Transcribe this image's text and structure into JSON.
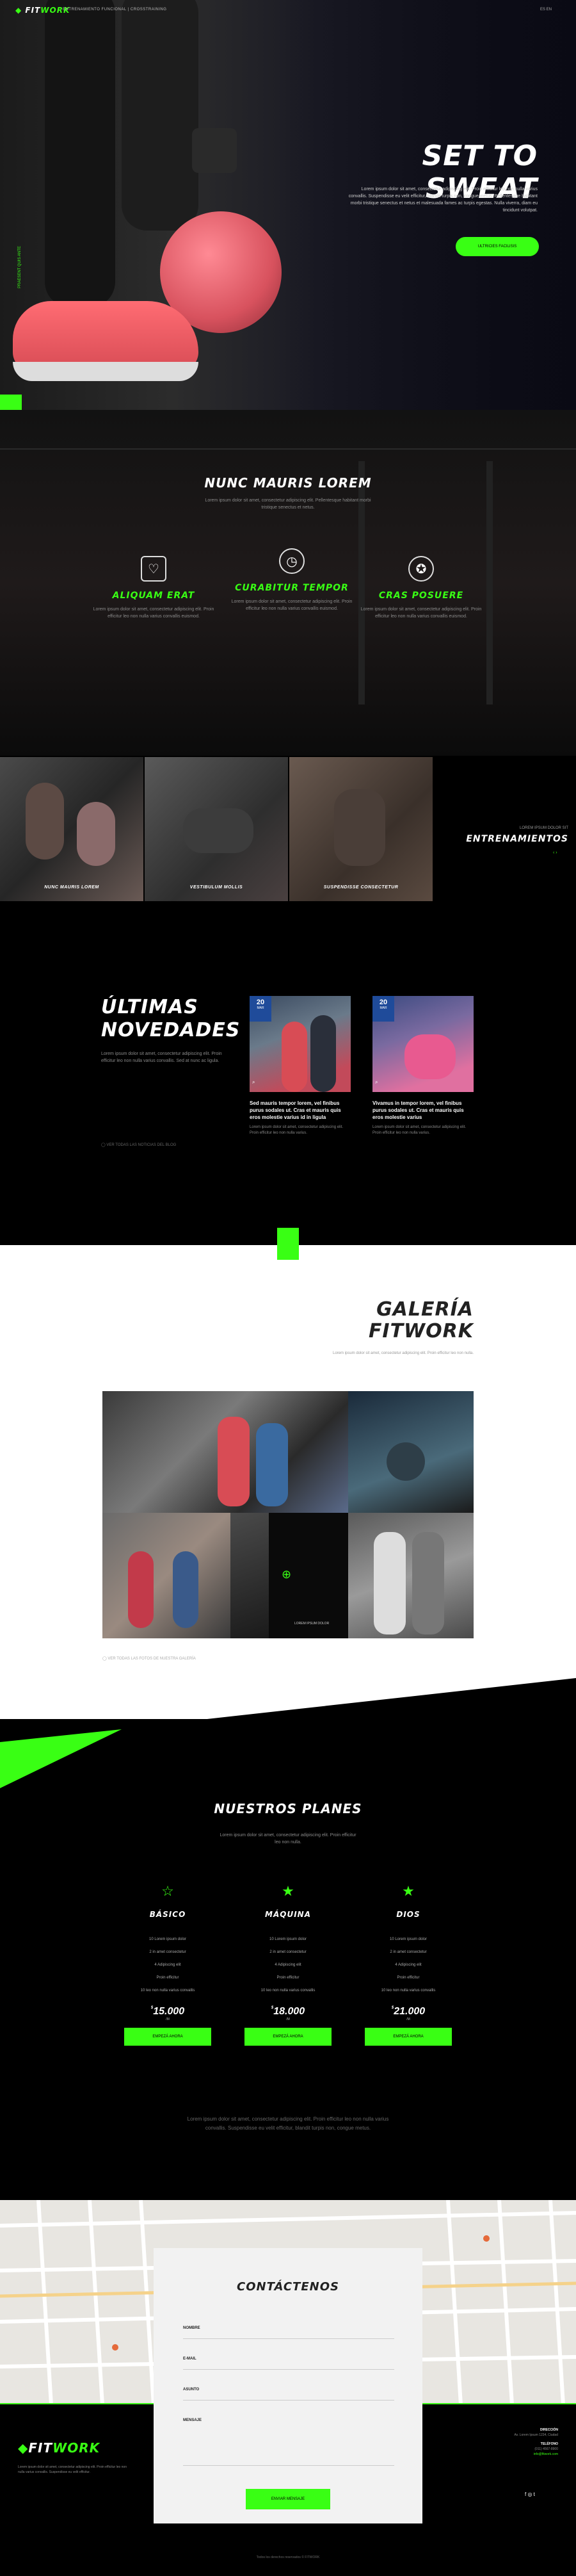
{
  "colors": {
    "accent": "#39ff14",
    "dark": "#000000",
    "date_badge": "#1f4b9a"
  },
  "header": {
    "logo_prefix": "FIT",
    "logo_suffix": "WORK",
    "tagline": "ENTRENAMIENTO FUNCIONAL | CROSSTRAINING",
    "lang": "ES  EN"
  },
  "hero": {
    "title": "SET TO SWEAT",
    "text": "Lorem ipsum dolor sit amet, consectetur adipiscing elit. Proin efficitur leo non nulla varius convallis. Suspendisse eu velit efficitur, blandit turpis non, congue metus. Pellentesque habitant morbi tristique senectus et netus et malesuada fames ac turpis egestas. Nulla viverra, diam eu tincidunt volutpat.",
    "button": "ULTRICIES FACILISIS",
    "side_text": "PRAESENT QUIS ANTE"
  },
  "features": {
    "title": "NUNC MAURIS LOREM",
    "subtitle": "Lorem ipsum dolor sit amet, consectetur adipiscing elit. Pellentesque habitant morbi tristique senectus et netus.",
    "items": [
      {
        "icon": "clipboard-heart-icon",
        "glyph": "♡",
        "title": "ALIQUAM ERAT",
        "text": "Lorem ipsum dolor sit amet, consectetur adipiscing elit. Proin efficitur leo non nulla varius convallis euismod."
      },
      {
        "icon": "stopwatch-icon",
        "glyph": "◷",
        "title": "CURABITUR TEMPOR",
        "text": "Lorem ipsum dolor sit amet, consectetur adipiscing elit. Proin efficitur leo non nulla varius convallis euismod."
      },
      {
        "icon": "medal-icon",
        "glyph": "✪",
        "title": "CRAS POSUERE",
        "text": "Lorem ipsum dolor sit amet, consectetur adipiscing elit. Proin efficitur leo non nulla varius convallis euismod."
      }
    ]
  },
  "classes": {
    "tiles": [
      {
        "label": "NUNC MAURIS LOREM"
      },
      {
        "label": "VESTIBULUM MOLLIS"
      },
      {
        "label": "SUSPENDISSE CONSECTETUR"
      }
    ],
    "kicker": "LOREM IPSUM DOLOR SIT",
    "title": "ENTRENAMIENTOS",
    "nav": "‹ ›"
  },
  "news": {
    "title_line1": "ÚLTIMAS",
    "title_line2": "NOVEDADES",
    "text": "Lorem ipsum dolor sit amet, consectetur adipiscing elit. Proin efficitur leo non nulla varius convallis. Sed at nunc ac ligula.",
    "more": "VER TODAS LAS NOTICIAS DEL BLOG",
    "cards": [
      {
        "day": "20",
        "month": "MAR",
        "title": "Sed mauris tempor lorem, vel finibus purus sodales ut. Cras et mauris quis eros molestie varius id in ligula",
        "text": "Lorem ipsum dolor sit amet, consectetur adipiscing elit. Proin efficitur leo non nulla varius."
      },
      {
        "day": "20",
        "month": "MAR",
        "title": "Vivamus in tempor lorem, vel finibus purus sodales ut. Cras et mauris quis eros molestie varius",
        "text": "Lorem ipsum dolor sit amet, consectetur adipiscing elit. Proin efficitur leo non nulla varius."
      }
    ]
  },
  "gallery": {
    "title_line1": "GALERÍA",
    "title_line2": "FITWORK",
    "subtitle": "Lorem ipsum dolor sit amet, consectetur adipiscing elit. Proin efficitur leo non nulla.",
    "overlay_caption": "LOREM IPSUM DOLOR",
    "note": "VER TODAS LAS FOTOS DE NUESTRA GALERÍA"
  },
  "plans": {
    "title": "NUESTROS PLANES",
    "subtitle": "Lorem ipsum dolor sit amet, consectetur adipiscing elit. Proin efficitur leo non nulla.",
    "items": [
      {
        "name": "BÁSICO",
        "features": [
          "10 Lorem ipsum dolor",
          "2 in amet consectetur",
          "4 Adipiscing elit",
          "Proin efficitur",
          "10 leo non nulla varius convallis"
        ],
        "currency": "$",
        "price": "15.000",
        "per": "/M",
        "button": "EMPEZÁ AHORA"
      },
      {
        "name": "MÁQUINA",
        "features": [
          "10 Lorem ipsum dolor",
          "2 in amet consectetur",
          "4 Adipiscing elit",
          "Proin efficitur",
          "10 leo non nulla varius convallis"
        ],
        "currency": "$",
        "price": "18.000",
        "per": "/M",
        "button": "EMPEZÁ AHORA"
      },
      {
        "name": "DIOS",
        "features": [
          "10 Lorem ipsum dolor",
          "2 in amet consectetur",
          "4 Adipiscing elit",
          "Proin efficitur",
          "10 leo non nulla varius convallis"
        ],
        "currency": "$",
        "price": "21.000",
        "per": "/M",
        "button": "EMPEZÁ AHORA"
      }
    ],
    "footnote": "Lorem ipsum dolor sit amet, consectetur adipiscing elit. Proin efficitur leo non nulla varius convallis. Suspendisse eu velit efficitur, blandit turpis non, congue metus."
  },
  "contact": {
    "title": "CONTÁCTENOS",
    "fields": [
      "NOMBRE",
      "E-MAIL",
      "ASUNTO",
      "MENSAJE"
    ],
    "button": "ENVIAR MENSAJE"
  },
  "footer": {
    "logo_prefix": "FIT",
    "logo_suffix": "WORK",
    "text": "Lorem ipsum dolor sit amet, consectetur adipiscing elit. Proin efficitur leo non nulla varius convallis. Suspendisse eu velit efficitur.",
    "address_title": "DIRECCIÓN",
    "address": "Av. Lorem Ipsum 1234, Ciudad",
    "phone_title": "TELÉFONO",
    "phone": "(011) 4567-8900",
    "email": "info@fitwork.com",
    "social": "f  ◎  t",
    "copyright": "Todos los derechos reservados © FITWORK"
  }
}
